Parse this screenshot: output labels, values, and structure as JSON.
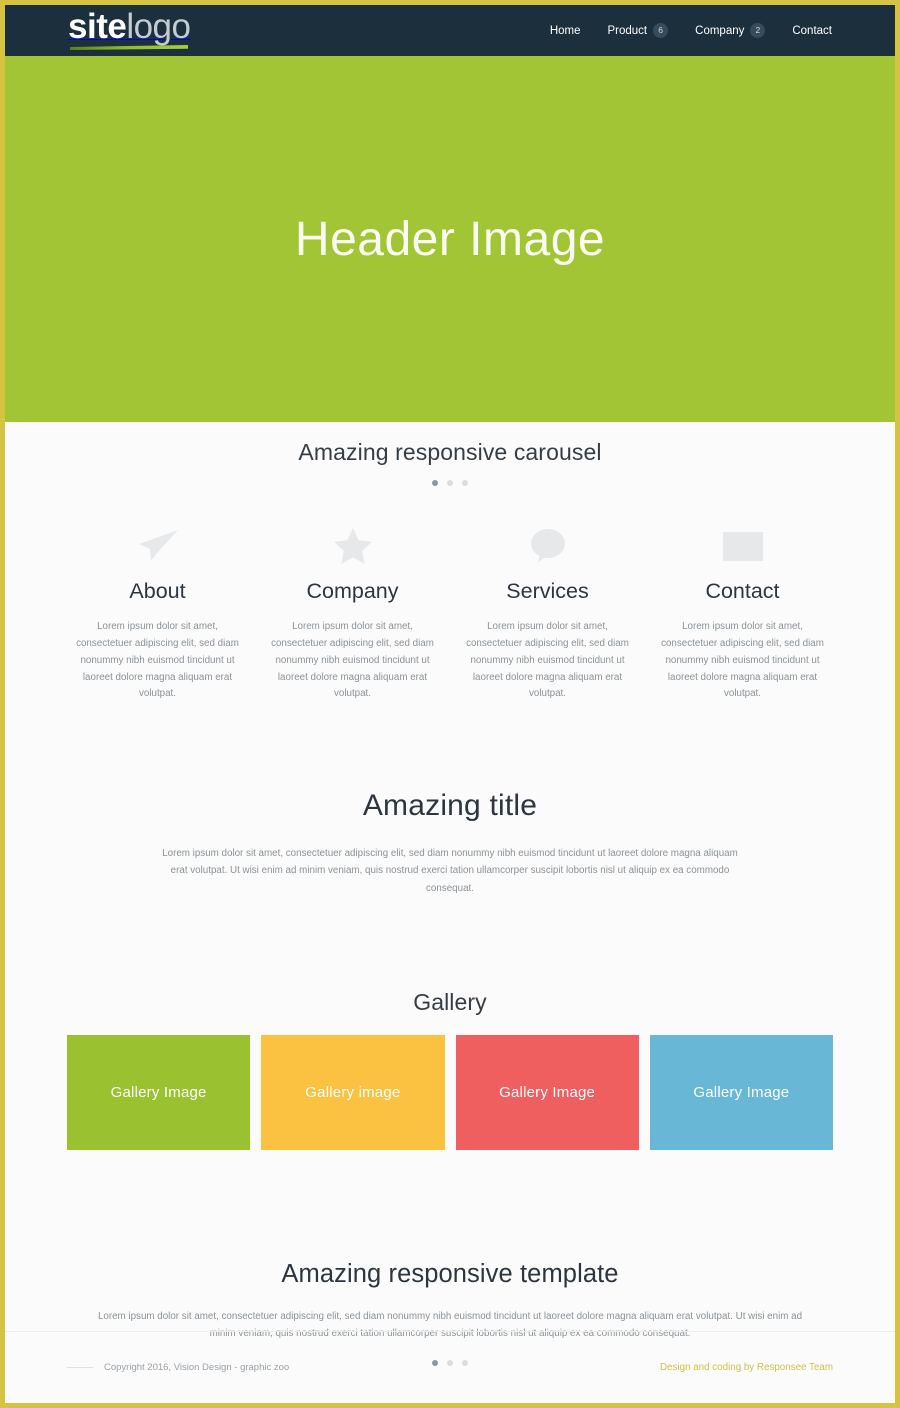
{
  "theme": {
    "page_border": "#d6c342",
    "header_bg": "#1b2f3d",
    "hero_bg": "#a2c535",
    "page_bg": "#fbfbfb",
    "credit_color": "#d1c04a"
  },
  "header": {
    "logo": {
      "bold": "site",
      "light": "logo"
    },
    "nav": [
      {
        "label": "Home",
        "badge": null
      },
      {
        "label": "Product",
        "badge": "6"
      },
      {
        "label": "Company",
        "badge": "2"
      },
      {
        "label": "Contact",
        "badge": null
      }
    ]
  },
  "hero": {
    "title": "Header Image"
  },
  "carousel": {
    "title": "Amazing responsive carousel",
    "dots": [
      true,
      false,
      false
    ]
  },
  "features": [
    {
      "icon": "paper-plane-icon",
      "title": "About",
      "text": "Lorem ipsum dolor sit amet, consectetuer adipiscing elit, sed diam nonummy nibh euismod tincidunt ut laoreet dolore magna aliquam erat volutpat."
    },
    {
      "icon": "star-icon",
      "title": "Company",
      "text": "Lorem ipsum dolor sit amet, consectetuer adipiscing elit, sed diam nonummy nibh euismod tincidunt ut laoreet dolore magna aliquam erat volutpat."
    },
    {
      "icon": "speech-bubble-icon",
      "title": "Services",
      "text": "Lorem ipsum dolor sit amet, consectetuer adipiscing elit, sed diam nonummy nibh euismod tincidunt ut laoreet dolore magna aliquam erat volutpat."
    },
    {
      "icon": "envelope-icon",
      "title": "Contact",
      "text": "Lorem ipsum dolor sit amet, consectetuer adipiscing elit, sed diam nonummy nibh euismod tincidunt ut laoreet dolore magna aliquam erat volutpat."
    }
  ],
  "amazing": {
    "title": "Amazing title",
    "text": "Lorem ipsum dolor sit amet, consectetuer adipiscing elit, sed diam nonummy nibh euismod tincidunt ut laoreet dolore magna aliquam erat volutpat. Ut wisi enim ad minim veniam, quis nostrud exerci tation ullamcorper suscipit lobortis nisl ut aliquip ex ea commodo consequat."
  },
  "gallery": {
    "title": "Gallery",
    "tiles": [
      {
        "label": "Gallery Image",
        "color": "#97c02a"
      },
      {
        "label": "Gallery image",
        "color": "#fbc03a"
      },
      {
        "label": "Gallery Image",
        "color": "#f05a5a"
      },
      {
        "label": "Gallery Image",
        "color": "#64b5d6"
      }
    ]
  },
  "responsive": {
    "title": "Amazing responsive template",
    "text": "Lorem ipsum dolor sit amet, consectetuer adipiscing elit, sed diam nonummy nibh euismod tincidunt ut laoreet dolore magna aliquam erat volutpat. Ut wisi enim ad minim veniam, quis nostrud exerci tation ullamcorper suscipit lobortis nisl ut aliquip ex ea commodo consequat.",
    "dots": [
      true,
      false,
      false
    ]
  },
  "footer": {
    "copyright": "Copyright 2016, Vision Design - graphic zoo",
    "credit": "Design and coding by Responsee Team"
  }
}
